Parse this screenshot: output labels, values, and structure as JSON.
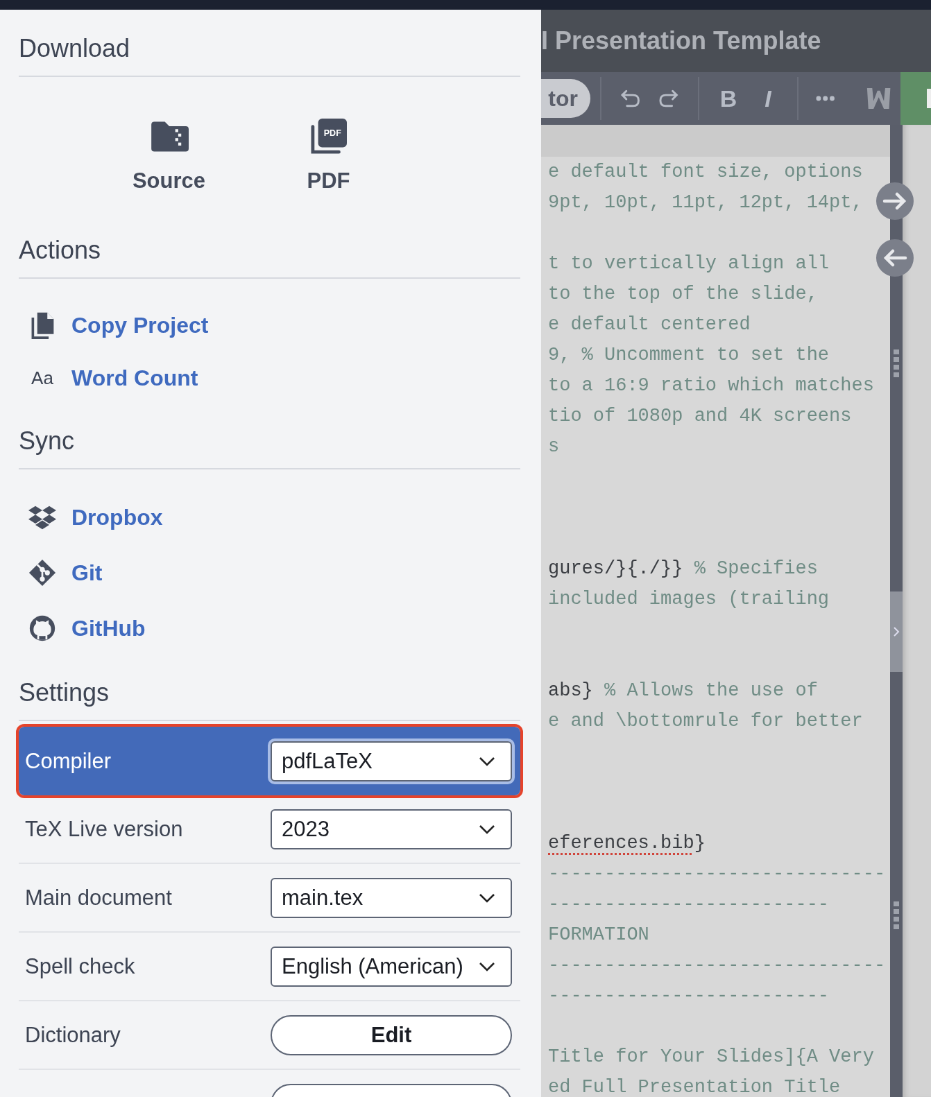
{
  "download": {
    "heading": "Download",
    "items": [
      {
        "label": "Source"
      },
      {
        "label": "PDF",
        "badge": "PDF"
      }
    ]
  },
  "actions": {
    "heading": "Actions",
    "items": [
      {
        "label": "Copy Project"
      },
      {
        "label": "Word Count",
        "icon_text": "Aa"
      }
    ]
  },
  "sync": {
    "heading": "Sync",
    "items": [
      {
        "label": "Dropbox"
      },
      {
        "label": "Git"
      },
      {
        "label": "GitHub"
      }
    ]
  },
  "settings": {
    "heading": "Settings",
    "rows": [
      {
        "label": "Compiler",
        "kind": "select",
        "value": "pdfLaTeX",
        "selected": true
      },
      {
        "label": "TeX Live version",
        "kind": "select",
        "value": "2023",
        "selected": false
      },
      {
        "label": "Main document",
        "kind": "select",
        "value": "main.tex",
        "selected": false
      },
      {
        "label": "Spell check",
        "kind": "select",
        "value": "English (American)",
        "selected": false
      },
      {
        "label": "Dictionary",
        "kind": "button",
        "value": "Edit",
        "selected": false
      },
      {
        "kind": "button",
        "selected": false
      }
    ]
  },
  "editor": {
    "title": "I Presentation Template",
    "mode_label": "tor",
    "format_buttons": [
      "B",
      "I"
    ],
    "lines": [
      {
        "kind": "text",
        "segments": [
          {
            "text": "e default font size, options",
            "kind": "comment"
          }
        ]
      },
      {
        "kind": "text",
        "segments": [
          {
            "text": "9pt, 10pt, 11pt, 12pt, 14pt,",
            "kind": "comment"
          }
        ]
      },
      {
        "kind": "blank"
      },
      {
        "kind": "text",
        "segments": [
          {
            "text": "t to vertically align all",
            "kind": "comment"
          }
        ]
      },
      {
        "kind": "text",
        "segments": [
          {
            "text": "to the top of the slide,",
            "kind": "comment"
          }
        ]
      },
      {
        "kind": "text",
        "segments": [
          {
            "text": "e default centered",
            "kind": "comment"
          }
        ]
      },
      {
        "kind": "text",
        "segments": [
          {
            "text": "9, % Uncomment to set the",
            "kind": "comment"
          }
        ]
      },
      {
        "kind": "text",
        "segments": [
          {
            "text": "to a 16:9 ratio which matches",
            "kind": "comment"
          }
        ]
      },
      {
        "kind": "text",
        "segments": [
          {
            "text": "tio of 1080p and 4K screens",
            "kind": "comment"
          }
        ]
      },
      {
        "kind": "text",
        "segments": [
          {
            "text": "s",
            "kind": "comment"
          }
        ]
      },
      {
        "kind": "blank"
      },
      {
        "kind": "blank"
      },
      {
        "kind": "blank"
      },
      {
        "kind": "text",
        "segments": [
          {
            "text": "gures/}{./}} ",
            "kind": "code"
          },
          {
            "text": "% Specifies",
            "kind": "comment"
          }
        ]
      },
      {
        "kind": "text",
        "segments": [
          {
            "text": "included images (trailing",
            "kind": "comment"
          }
        ]
      },
      {
        "kind": "blank"
      },
      {
        "kind": "blank"
      },
      {
        "kind": "text",
        "segments": [
          {
            "text": "abs} ",
            "kind": "code"
          },
          {
            "text": "% Allows the use of",
            "kind": "comment"
          }
        ]
      },
      {
        "kind": "text",
        "segments": [
          {
            "text": "e and \\bottomrule for better",
            "kind": "comment"
          }
        ]
      },
      {
        "kind": "blank"
      },
      {
        "kind": "blank"
      },
      {
        "kind": "blank"
      },
      {
        "kind": "text",
        "segments": [
          {
            "text": "eferences.bib",
            "kind": "misspelled"
          },
          {
            "text": "}",
            "kind": "code"
          }
        ]
      },
      {
        "kind": "text",
        "segments": [
          {
            "text": "------------------------------",
            "kind": "comment"
          }
        ]
      },
      {
        "kind": "text",
        "segments": [
          {
            "text": "-------------------------",
            "kind": "comment"
          }
        ]
      },
      {
        "kind": "text",
        "segments": [
          {
            "text": "FORMATION",
            "kind": "comment"
          }
        ]
      },
      {
        "kind": "text",
        "segments": [
          {
            "text": "------------------------------",
            "kind": "comment"
          }
        ]
      },
      {
        "kind": "text",
        "segments": [
          {
            "text": "-------------------------",
            "kind": "comment"
          }
        ]
      },
      {
        "kind": "blank"
      },
      {
        "kind": "text",
        "segments": [
          {
            "text": "Title for Your Slides]{A Very",
            "kind": "comment"
          }
        ]
      },
      {
        "kind": "text",
        "segments": [
          {
            "text": "ed Full Presentation Title",
            "kind": "comment"
          }
        ]
      }
    ]
  }
}
